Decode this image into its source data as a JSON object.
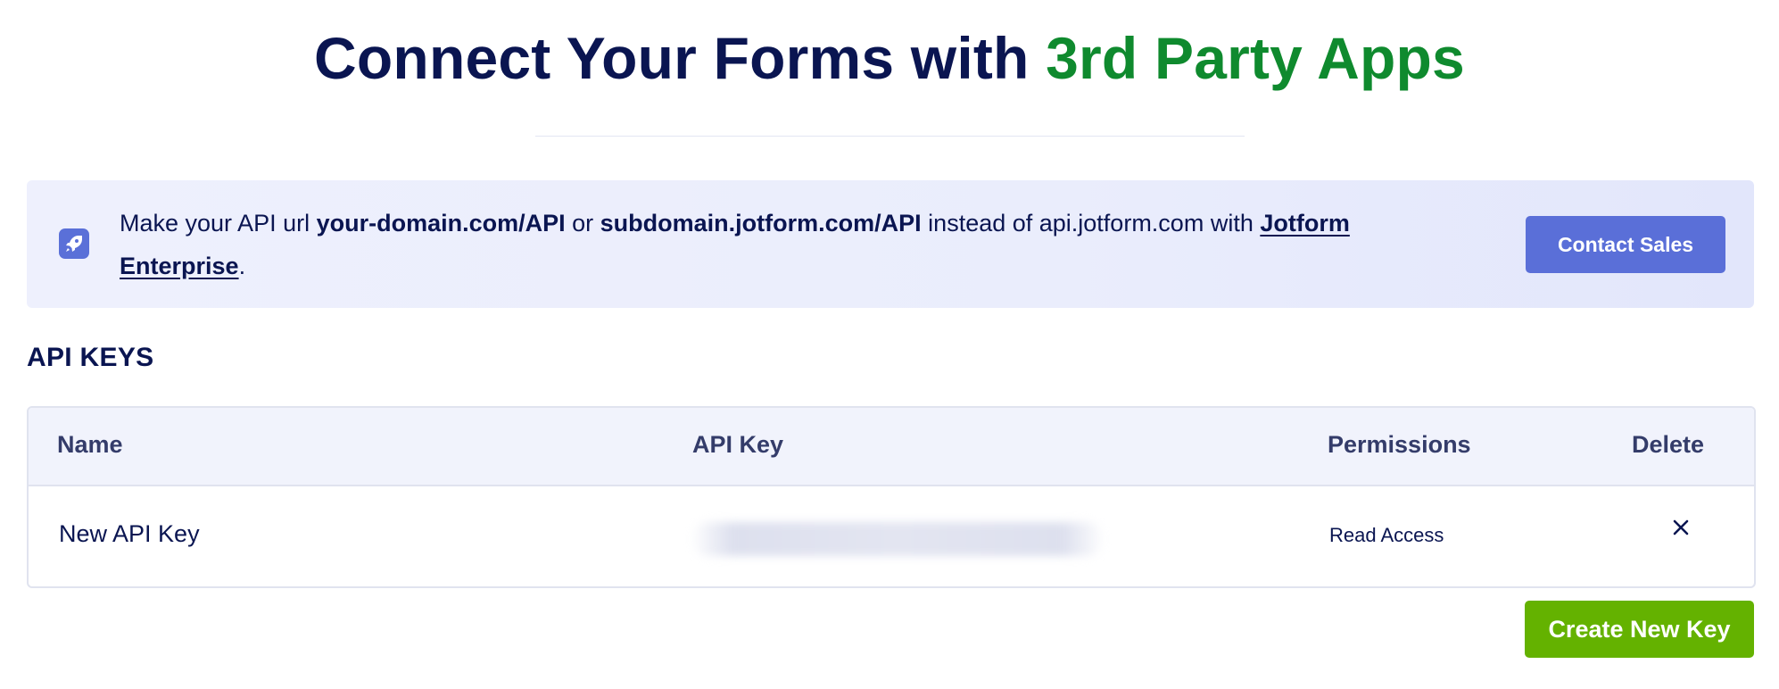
{
  "header": {
    "title_main": "Connect Your Forms with ",
    "title_accent": "3rd Party Apps"
  },
  "banner": {
    "icon": "rocket-icon",
    "text_1": "Make your API url ",
    "text_bold_1": "your-domain.com/API",
    "text_2": " or ",
    "text_bold_2": "subdomain.jotform.com/API",
    "text_3": " instead of api.jotform.com with ",
    "link_text": "Jotform Enterprise",
    "text_4": ".",
    "button_label": "Contact Sales"
  },
  "api_keys": {
    "section_title": "API KEYS",
    "columns": [
      "Name",
      "API Key",
      "Permissions",
      "Delete"
    ],
    "rows": [
      {
        "name": "New API Key",
        "key": "",
        "permissions": "Read Access",
        "delete_icon": "close-icon"
      }
    ],
    "create_button_label": "Create New Key"
  },
  "colors": {
    "navy": "#0a1551",
    "green_accent": "#0f8a2e",
    "contact_button": "#5a6fd8",
    "create_button": "#64b200"
  }
}
